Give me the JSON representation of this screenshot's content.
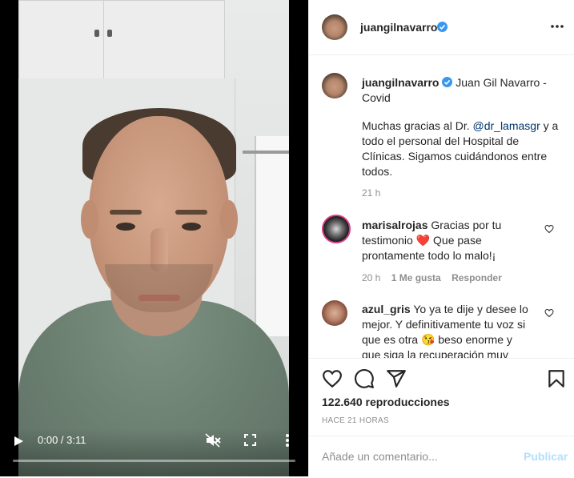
{
  "video": {
    "time": "0:00 / 3:11",
    "progress_fraction": 0.0,
    "icons": {
      "play": "play-icon",
      "mute": "volume-muted-icon",
      "fullscreen": "fullscreen-icon",
      "more": "more-vertical-icon"
    }
  },
  "header": {
    "username": "juangilnavarro",
    "verified_icon": "verified-badge-icon",
    "more_icon": "more-horizontal-icon"
  },
  "caption": {
    "username": "juangilnavarro",
    "title": "Juan Gil Navarro - Covid",
    "line1_pre": "Muchas gracias al Dr. ",
    "mention": "@dr_lamasgr",
    "line1_post": " y a",
    "line2": "todo el personal del Hospital de",
    "line3": "Clínicas. Sigamos cuidándonos entre",
    "line4": "todos.",
    "time": "21 h"
  },
  "comments": [
    {
      "username": "marisalrojas",
      "line1": "Gracias por tu",
      "line2_pre": "testimonio ",
      "emoji_mid": "❤️",
      "line2_post": " Que pase",
      "line3": "prontamente todo lo malo!¡",
      "time": "20 h",
      "likes": "1 Me gusta",
      "reply": "Responder"
    },
    {
      "username": "azul_gris",
      "line1": "Yo ya te dije y desee lo",
      "line2": "mejor. Y definitivamente tu voz si",
      "line3_pre": "que es otra ",
      "emoji_mid": "😘",
      "line3_post": " beso enorme y",
      "line4": "que siga la recuperación muy"
    }
  ],
  "actions": {
    "icons": [
      "heart-icon",
      "comment-icon",
      "share-icon",
      "save-icon"
    ],
    "views": "122.640 reproducciones",
    "ago": "HACE 21 HORAS"
  },
  "add_comment": {
    "placeholder": "Añade un comentario...",
    "publish": "Publicar"
  },
  "colors": {
    "verified": "#3897f0",
    "link": "#00376b",
    "publish_disabled": "#b2dffc",
    "heart_red": "#ed4956"
  }
}
